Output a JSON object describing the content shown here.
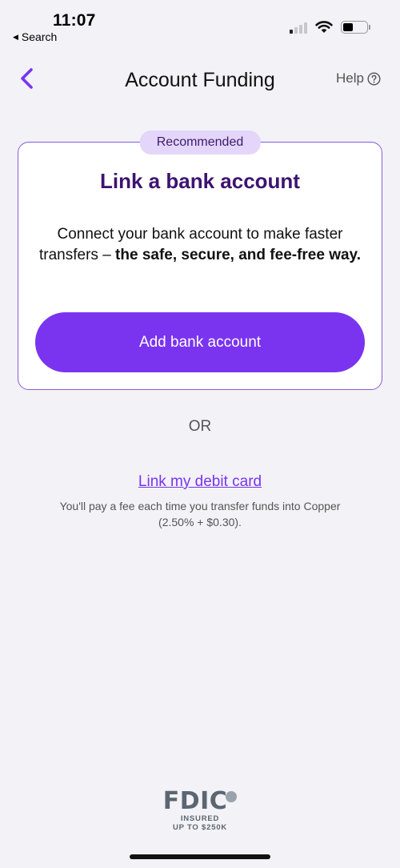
{
  "status_bar": {
    "time": "11:07",
    "back_label": "Search",
    "icons": [
      "signal-icon",
      "wifi-icon",
      "battery-icon"
    ]
  },
  "nav": {
    "title": "Account Funding",
    "help_label": "Help",
    "back_icon": "chevron-left-icon",
    "help_icon": "question-circle-icon"
  },
  "card": {
    "badge": "Recommended",
    "title": "Link a bank account",
    "body_plain": "Connect your bank account to make faster transfers – ",
    "body_bold": "the safe, secure, and fee-free way.",
    "button_label": "Add bank account"
  },
  "divider_text": "OR",
  "debit": {
    "link_label": "Link my debit card",
    "note": "You'll pay a fee each time you transfer funds into Copper (2.50% + $0.30)."
  },
  "footer": {
    "logo_text": "FDIC",
    "line1": "INSURED",
    "line2": "UP TO $250K"
  },
  "colors": {
    "accent": "#7a34f0",
    "title_purple": "#3d1370",
    "badge_bg": "#e4d6fb",
    "background": "#f2f2f7"
  }
}
